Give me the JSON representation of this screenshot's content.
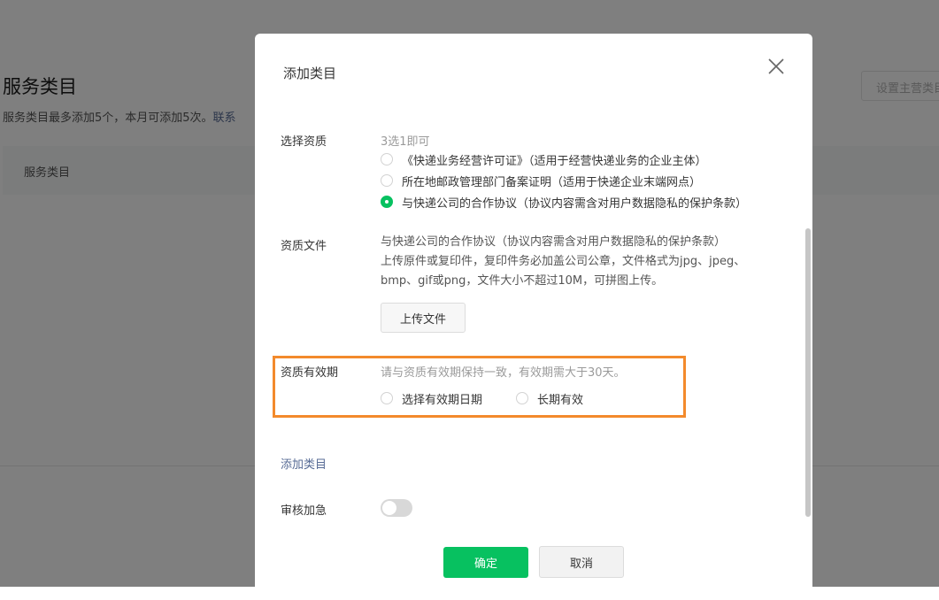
{
  "background": {
    "title": "服务类目",
    "desc": "服务类目最多添加5个，本月可添加5次。",
    "desc_link": "联系",
    "table_header": "服务类目",
    "top_button": "设置主营类目"
  },
  "dialog": {
    "title": "添加类目",
    "qualification": {
      "label": "选择资质",
      "hint": "3选1即可",
      "options": [
        {
          "label": "《快递业务经营许可证》（适用于经营快递业务的企业主体）",
          "checked": false
        },
        {
          "label": "所在地邮政管理部门备案证明（适用于快递企业末端网点）",
          "checked": false
        },
        {
          "label": "与快递公司的合作协议（协议内容需含对用户数据隐私的保护条款）",
          "checked": true
        }
      ]
    },
    "qualification_file": {
      "label": "资质文件",
      "line1": "与快递公司的合作协议（协议内容需含对用户数据隐私的保护条款）",
      "line2": "上传原件或复印件，复印件务必加盖公司公章，文件格式为jpg、jpeg、bmp、gif或png，文件大小不超过10M，可拼图上传。",
      "upload_button": "上传文件"
    },
    "validity": {
      "label": "资质有效期",
      "hint": "请与资质有效期保持一致，有效期需大于30天。",
      "options": [
        {
          "label": "选择有效期日期",
          "checked": false
        },
        {
          "label": "长期有效",
          "checked": false
        }
      ]
    },
    "add_category_link": "添加类目",
    "expedite": {
      "label": "审核加急",
      "enabled": false
    },
    "confirm_button": "确定",
    "cancel_button": "取消"
  },
  "colors": {
    "primary": "#07c160",
    "link": "#576b95",
    "highlight": "#f38a2c"
  }
}
